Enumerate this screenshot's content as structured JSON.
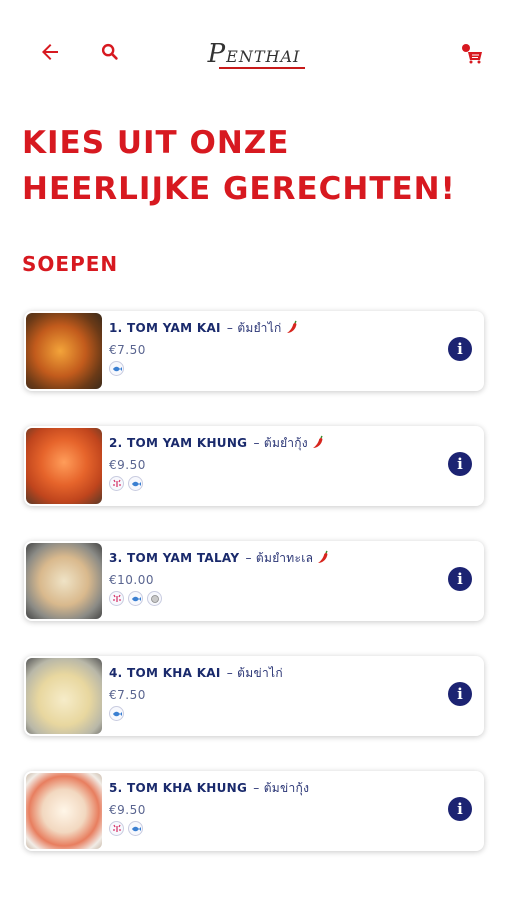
{
  "header": {
    "logo_initial": "P",
    "logo_rest": "ENTHAI"
  },
  "title_line1": "Kies uit onze",
  "title_line2": "heerlijke gerechten!",
  "section_title": "Soepen",
  "colors": {
    "accent_red": "#d71920",
    "navy": "#1c2372"
  },
  "items": [
    {
      "name": "1. Tom Yam Kai",
      "thai": "– ต้มยำไก่",
      "spicy": true,
      "price": "€7.50",
      "allergens": [
        "fish-allergen-icon"
      ]
    },
    {
      "name": "2. Tom Yam Khung",
      "thai": "– ต้มยำกุ้ง",
      "spicy": true,
      "price": "€9.50",
      "allergens": [
        "crustacean-allergen-icon",
        "fish-allergen-icon"
      ]
    },
    {
      "name": "3. Tom Yam Talay",
      "thai": "– ต้มยำทะเล",
      "spicy": true,
      "price": "€10.00",
      "allergens": [
        "crustacean-allergen-icon",
        "fish-allergen-icon",
        "mollusc-allergen-icon"
      ]
    },
    {
      "name": "4. Tom Kha Kai",
      "thai": "– ต้มข่าไก่",
      "spicy": false,
      "price": "€7.50",
      "allergens": [
        "fish-allergen-icon"
      ]
    },
    {
      "name": "5. Tom Kha Khung",
      "thai": "– ต้มข่ากุ้ง",
      "spicy": false,
      "price": "€9.50",
      "allergens": [
        "crustacean-allergen-icon",
        "fish-allergen-icon"
      ]
    }
  ]
}
